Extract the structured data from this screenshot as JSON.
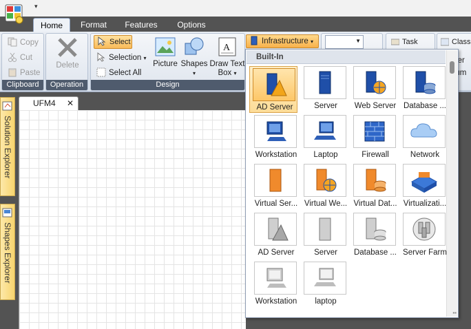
{
  "menu_tabs": [
    "Home",
    "Format",
    "Features",
    "Options"
  ],
  "qat": {
    "dropdown_glyph": "▾"
  },
  "clipboard": {
    "copy": "Copy",
    "cut": "Cut",
    "paste": "Paste",
    "label": "Clipboard"
  },
  "operation": {
    "delete": "Delete",
    "label": "Operation"
  },
  "design": {
    "select": "Select",
    "selection": "Selection",
    "select_all": "Select All",
    "picture": "Picture",
    "shapes": "Shapes",
    "draw_text": "Draw Text",
    "box": "Box",
    "label": "Design"
  },
  "infra": {
    "label": "Infrastructure"
  },
  "right": {
    "task": "Task",
    "class": "Class",
    "inter": "nter",
    "enum": "num"
  },
  "side": {
    "solution": "Solution Explorer",
    "shapes": "Shapes Explorer"
  },
  "doc": {
    "tab": "UFM4",
    "close": "✕"
  },
  "gallery": {
    "header": "Built-In",
    "items": [
      "AD Server",
      "Server",
      "Web Server",
      "Database ...",
      "Workstation",
      "Laptop",
      "Firewall",
      "Network",
      "Virtual Ser...",
      "Virtual We...",
      "Virtual Dat...",
      "Virtualizati...",
      "AD Server",
      "Server",
      "Database ...",
      "Server Farm",
      "Workstation",
      "laptop"
    ]
  },
  "colors": {
    "accent": "#f8b14a",
    "ribbon_label": "#4f5b6d",
    "server_blue": "#1f4fa8",
    "virtual_orange": "#f08a2c",
    "gray": "#8a8a8a"
  }
}
